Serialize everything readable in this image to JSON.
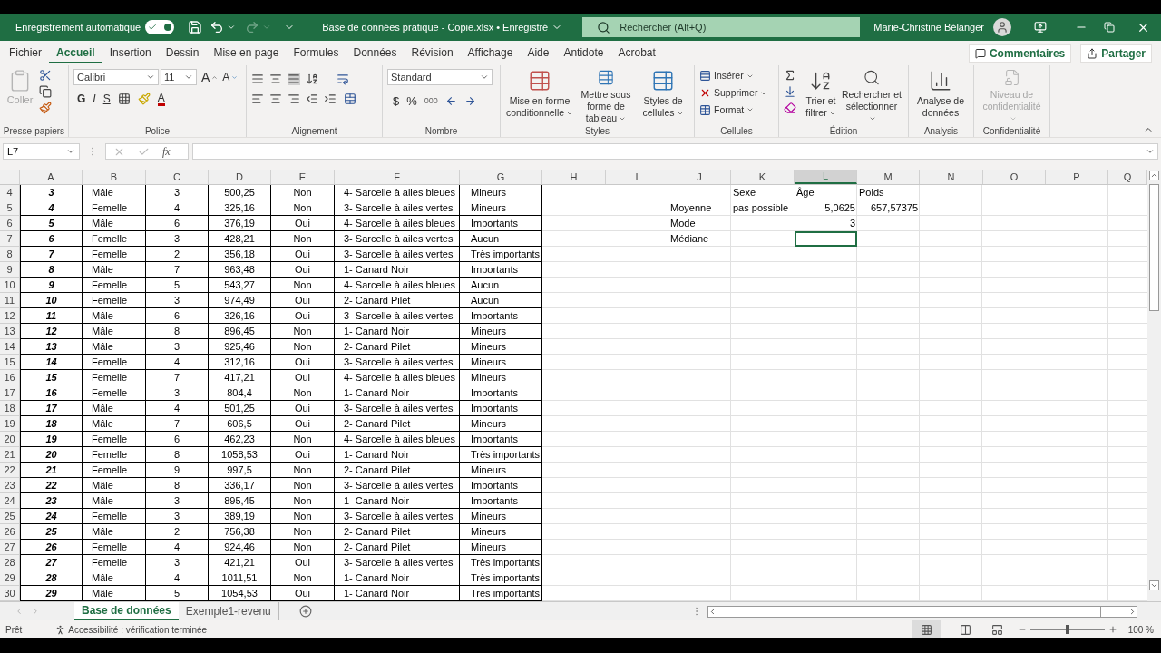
{
  "title_bar": {
    "autosave_label": "Enregistrement automatique",
    "autosave_on": true,
    "document_title": "Base de données pratique - Copie.xlsx • Enregistré",
    "search_placeholder": "Rechercher (Alt+Q)",
    "user_name": "Marie-Christine Bélanger"
  },
  "menu_tabs": [
    {
      "label": "Fichier",
      "selected": false
    },
    {
      "label": "Accueil",
      "selected": true
    },
    {
      "label": "Insertion",
      "selected": false
    },
    {
      "label": "Dessin",
      "selected": false
    },
    {
      "label": "Mise en page",
      "selected": false
    },
    {
      "label": "Formules",
      "selected": false
    },
    {
      "label": "Données",
      "selected": false
    },
    {
      "label": "Révision",
      "selected": false
    },
    {
      "label": "Affichage",
      "selected": false
    },
    {
      "label": "Aide",
      "selected": false
    },
    {
      "label": "Antidote",
      "selected": false
    },
    {
      "label": "Acrobat",
      "selected": false
    }
  ],
  "comments_button": "Commentaires",
  "share_button": "Partager",
  "ribbon": {
    "clipboard": {
      "label": "Presse-papiers",
      "paste": "Coller",
      "paste_disabled": true
    },
    "font": {
      "label": "Police",
      "name": "Calibri",
      "size": "11",
      "grow": "A",
      "shrink": "A",
      "bold": "G",
      "italic": "I",
      "underline": "S",
      "color_button": "A"
    },
    "alignment": {
      "label": "Alignement"
    },
    "number": {
      "label": "Nombre",
      "format": "Standard",
      "currency": "$",
      "percent": "%",
      "thousands": "000"
    },
    "styles": {
      "label": "Styles",
      "buttons": [
        "Mise en forme conditionnelle",
        "Mettre sous forme de tableau",
        "Styles de cellules"
      ]
    },
    "cells": {
      "label": "Cellules",
      "buttons": [
        "Insérer",
        "Supprimer",
        "Format"
      ]
    },
    "editing": {
      "label": "Édition",
      "buttons": [
        "Trier et filtrer",
        "Rechercher et sélectionner"
      ]
    },
    "analysis": {
      "label": "Analysis",
      "button": "Analyse de données"
    },
    "confidentiality": {
      "label": "Confidentialité",
      "button": "Niveau de confidentialité",
      "disabled": true
    }
  },
  "formula_bar": {
    "name_box": "L7",
    "fx": "fx"
  },
  "columns": [
    {
      "label": "A",
      "selected": false
    },
    {
      "label": "B",
      "selected": false
    },
    {
      "label": "C",
      "selected": false
    },
    {
      "label": "D",
      "selected": false
    },
    {
      "label": "E",
      "selected": false
    },
    {
      "label": "F",
      "selected": false
    },
    {
      "label": "G",
      "selected": false
    },
    {
      "label": "H",
      "selected": false
    },
    {
      "label": "I",
      "selected": false
    },
    {
      "label": "J",
      "selected": false
    },
    {
      "label": "K",
      "selected": false
    },
    {
      "label": "L",
      "selected": true
    },
    {
      "label": "M",
      "selected": false
    },
    {
      "label": "N",
      "selected": false
    },
    {
      "label": "O",
      "selected": false
    },
    {
      "label": "P",
      "selected": false
    },
    {
      "label": "Q",
      "selected": false
    }
  ],
  "rows": [
    {
      "number": "4",
      "cells": [
        "3",
        "Mâle",
        "3",
        "500,25",
        "Non",
        "4- Sarcelle à ailes bleues",
        "Mineurs"
      ]
    },
    {
      "number": "5",
      "cells": [
        "4",
        "Femelle",
        "4",
        "325,16",
        "Non",
        "3- Sarcelle à ailes vertes",
        "Mineurs"
      ]
    },
    {
      "number": "6",
      "cells": [
        "5",
        "Mâle",
        "6",
        "376,19",
        "Oui",
        "4- Sarcelle à ailes bleues",
        "Importants"
      ]
    },
    {
      "number": "7",
      "cells": [
        "6",
        "Femelle",
        "3",
        "428,21",
        "Non",
        "3- Sarcelle à ailes vertes",
        "Aucun"
      ]
    },
    {
      "number": "8",
      "cells": [
        "7",
        "Femelle",
        "2",
        "356,18",
        "Oui",
        "3- Sarcelle à ailes vertes",
        "Très importants"
      ]
    },
    {
      "number": "9",
      "cells": [
        "8",
        "Mâle",
        "7",
        "963,48",
        "Oui",
        "1- Canard Noir",
        "Importants"
      ]
    },
    {
      "number": "10",
      "cells": [
        "9",
        "Femelle",
        "5",
        "543,27",
        "Non",
        "4- Sarcelle à ailes bleues",
        "Aucun"
      ]
    },
    {
      "number": "11",
      "cells": [
        "10",
        "Femelle",
        "3",
        "974,49",
        "Oui",
        "2- Canard Pilet",
        "Aucun"
      ]
    },
    {
      "number": "12",
      "cells": [
        "11",
        "Mâle",
        "6",
        "326,16",
        "Oui",
        "3- Sarcelle à ailes vertes",
        "Importants"
      ]
    },
    {
      "number": "13",
      "cells": [
        "12",
        "Mâle",
        "8",
        "896,45",
        "Non",
        "1- Canard Noir",
        "Mineurs"
      ]
    },
    {
      "number": "14",
      "cells": [
        "13",
        "Mâle",
        "3",
        "925,46",
        "Non",
        "2- Canard Pilet",
        "Mineurs"
      ]
    },
    {
      "number": "15",
      "cells": [
        "14",
        "Femelle",
        "4",
        "312,16",
        "Oui",
        "3- Sarcelle à ailes vertes",
        "Mineurs"
      ]
    },
    {
      "number": "16",
      "cells": [
        "15",
        "Femelle",
        "7",
        "417,21",
        "Oui",
        "4- Sarcelle à ailes bleues",
        "Mineurs"
      ]
    },
    {
      "number": "17",
      "cells": [
        "16",
        "Femelle",
        "3",
        "804,4",
        "Non",
        "1- Canard Noir",
        "Importants"
      ]
    },
    {
      "number": "18",
      "cells": [
        "17",
        "Mâle",
        "4",
        "501,25",
        "Oui",
        "3- Sarcelle à ailes vertes",
        "Importants"
      ]
    },
    {
      "number": "19",
      "cells": [
        "18",
        "Mâle",
        "7",
        "606,5",
        "Oui",
        "2- Canard Pilet",
        "Mineurs"
      ]
    },
    {
      "number": "20",
      "cells": [
        "19",
        "Femelle",
        "6",
        "462,23",
        "Non",
        "4- Sarcelle à ailes bleues",
        "Importants"
      ]
    },
    {
      "number": "21",
      "cells": [
        "20",
        "Femelle",
        "8",
        "1058,53",
        "Oui",
        "1- Canard Noir",
        "Très importants"
      ]
    },
    {
      "number": "22",
      "cells": [
        "21",
        "Femelle",
        "9",
        "997,5",
        "Non",
        "2- Canard Pilet",
        "Mineurs"
      ]
    },
    {
      "number": "23",
      "cells": [
        "22",
        "Mâle",
        "8",
        "336,17",
        "Non",
        "3- Sarcelle à ailes vertes",
        "Importants"
      ]
    },
    {
      "number": "24",
      "cells": [
        "23",
        "Mâle",
        "3",
        "895,45",
        "Non",
        "1- Canard Noir",
        "Importants"
      ]
    },
    {
      "number": "25",
      "cells": [
        "24",
        "Femelle",
        "3",
        "389,19",
        "Non",
        "3- Sarcelle à ailes vertes",
        "Mineurs"
      ]
    },
    {
      "number": "26",
      "cells": [
        "25",
        "Mâle",
        "2",
        "756,38",
        "Non",
        "2- Canard Pilet",
        "Mineurs"
      ]
    },
    {
      "number": "27",
      "cells": [
        "26",
        "Femelle",
        "4",
        "924,46",
        "Non",
        "2- Canard Pilet",
        "Mineurs"
      ]
    },
    {
      "number": "28",
      "cells": [
        "27",
        "Femelle",
        "3",
        "421,21",
        "Oui",
        "3- Sarcelle à ailes vertes",
        "Très importants"
      ]
    },
    {
      "number": "29",
      "cells": [
        "28",
        "Mâle",
        "4",
        "1011,51",
        "Non",
        "1- Canard Noir",
        "Très importants"
      ]
    },
    {
      "number": "30",
      "cells": [
        "29",
        "Mâle",
        "5",
        "1054,53",
        "Oui",
        "1- Canard Noir",
        "Très importants"
      ]
    }
  ],
  "summary": [
    {
      "cells": [
        {
          "selected": false
        },
        {
          "text": "Sexe",
          "kind": "text",
          "selected": false
        },
        {
          "text": "Âge",
          "kind": "text",
          "selected": false
        },
        {
          "text": "Poids",
          "kind": "text",
          "selected": false
        }
      ]
    },
    {
      "cells": [
        {
          "text": "Moyenne",
          "kind": "text",
          "selected": false
        },
        {
          "text": "pas possible",
          "kind": "text",
          "selected": false
        },
        {
          "text": "5,0625",
          "kind": "number",
          "selected": false
        },
        {
          "text": "657,57375",
          "kind": "number",
          "selected": false
        }
      ]
    },
    {
      "cells": [
        {
          "text": "Mode",
          "kind": "text",
          "selected": false
        },
        {
          "selected": false
        },
        {
          "text": "3",
          "kind": "number",
          "selected": false
        },
        {
          "selected": false
        }
      ]
    },
    {
      "cells": [
        {
          "text": "Médiane",
          "kind": "text",
          "selected": false
        },
        {
          "selected": false
        },
        {
          "selected": true
        },
        {
          "selected": false
        }
      ]
    }
  ],
  "sheet_tabs": [
    {
      "label": "Base de données",
      "selected": true
    },
    {
      "label": "Exemple1-revenu",
      "selected": false
    }
  ],
  "status_bar": {
    "state": "Prêt",
    "accessibility": "Accessibilité : vérification terminée",
    "level": 0.5,
    "zoom": "100 %"
  }
}
